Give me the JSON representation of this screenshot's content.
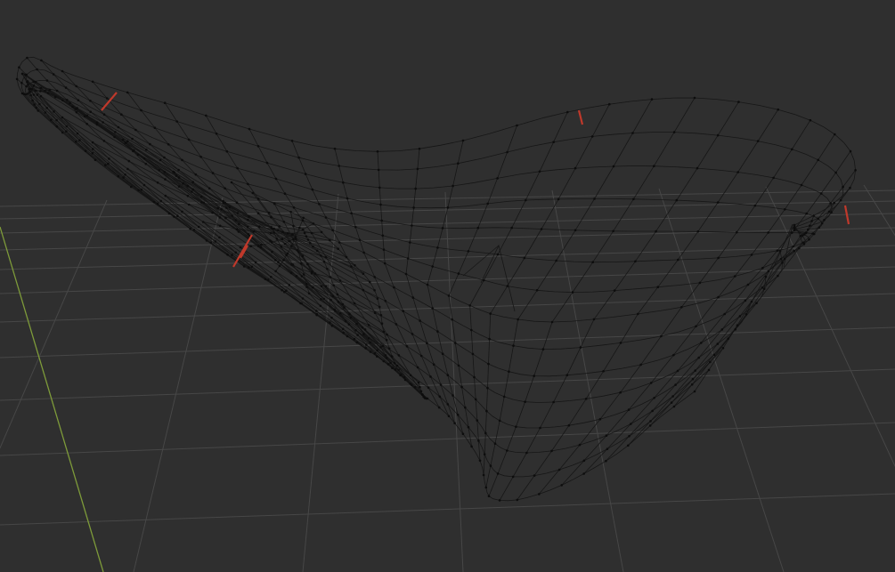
{
  "viewport": {
    "name": "3D Viewport",
    "background_color": "#2f2f2f",
    "grid_color": "#474747",
    "y_axis_color": "#7e9b3a",
    "mesh_wire_color": "#141414",
    "mesh_vertex_color": "#0d0d0d",
    "seam_color": "#c0392b",
    "grid_visible": true,
    "object": "mesh-wireframe",
    "mode": "edit",
    "seams_marked": 5
  }
}
